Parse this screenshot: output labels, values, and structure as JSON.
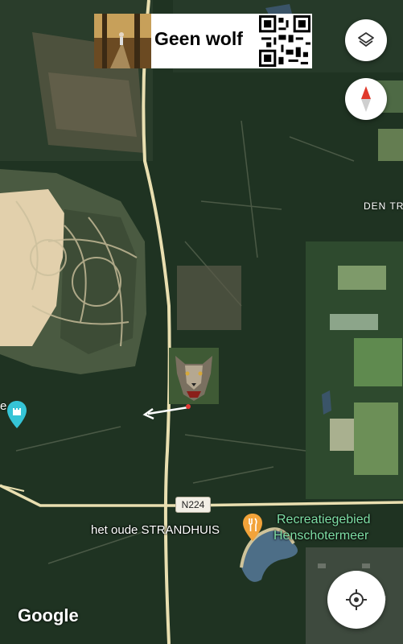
{
  "map": {
    "road_shield": "N224",
    "restaurant_label": "het oude STRANDHUIS",
    "poi_label_line1": "Recreatiegebied",
    "poi_label_line2": "Henschotermeer",
    "place_label": "DEN TR",
    "edge_label": "e",
    "attribution": "Google"
  },
  "overlay": {
    "title": "Geen wolf"
  },
  "controls": {
    "layers_icon": "layers-icon",
    "compass_icon": "compass-icon",
    "location_icon": "my-location-icon"
  },
  "colors": {
    "poi_green": "#7fe0a6",
    "food_pin": "#f2a33a",
    "poi_pin": "#35c4d6",
    "road": "#e9dfb0",
    "sand": "#e7d6b5",
    "water": "#4d6e87"
  }
}
